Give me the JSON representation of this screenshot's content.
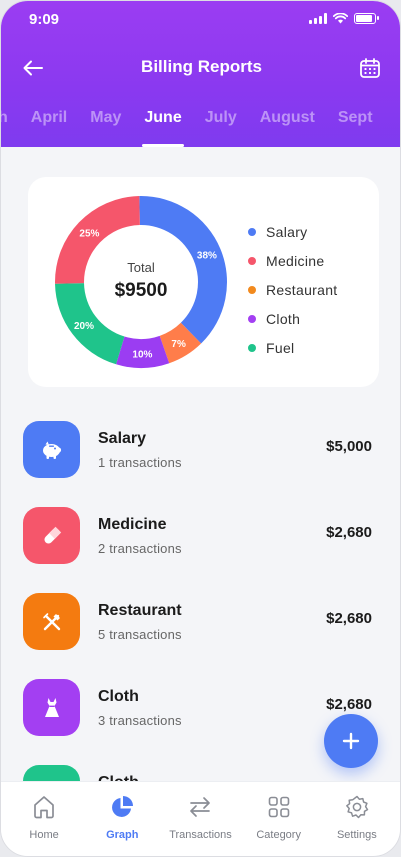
{
  "status_bar": {
    "time": "9:09"
  },
  "header": {
    "title": "Billing Reports"
  },
  "months": [
    "arch",
    "April",
    "May",
    "June",
    "July",
    "August",
    "Sept"
  ],
  "active_month": "June",
  "chart_data": {
    "type": "pie",
    "center_label": "Total",
    "center_value": "$9500",
    "slices": [
      {
        "name": "Salary",
        "value": 38,
        "label": "38%",
        "color": "#4e7bf4"
      },
      {
        "name": "Restaurant",
        "value": 7,
        "label": "7%",
        "color": "#ff7d4a"
      },
      {
        "name": "Cloth",
        "value": 10,
        "label": "10%",
        "color": "#9b3df2"
      },
      {
        "name": "Fuel",
        "value": 20,
        "label": "20%",
        "color": "#1fc48b"
      },
      {
        "name": "Medicine",
        "value": 25,
        "label": "25%",
        "color": "#f5566b"
      }
    ],
    "legend": [
      {
        "name": "Salary",
        "color": "#4e7bf4"
      },
      {
        "name": "Medicine",
        "color": "#f5566b"
      },
      {
        "name": "Restaurant",
        "color": "#f28a1e"
      },
      {
        "name": "Cloth",
        "color": "#a33ff2"
      },
      {
        "name": "Fuel",
        "color": "#1fc48b"
      }
    ]
  },
  "transactions": [
    {
      "name": "Salary",
      "sub": "1 transactions",
      "amount": "$5,000",
      "color": "#4e7bf4",
      "icon": "piggy-bank-icon"
    },
    {
      "name": "Medicine",
      "sub": "2 transactions",
      "amount": "$2,680",
      "color": "#f5566b",
      "icon": "pill-icon"
    },
    {
      "name": "Restaurant",
      "sub": "5 transactions",
      "amount": "$2,680",
      "color": "#f47b10",
      "icon": "cutlery-icon"
    },
    {
      "name": "Cloth",
      "sub": "3 transactions",
      "amount": "$2,680",
      "color": "#a33ff2",
      "icon": "dress-icon"
    },
    {
      "name": "Cloth",
      "sub": "",
      "amount": "",
      "color": "#1fc48b",
      "icon": "category-icon"
    }
  ],
  "nav": [
    {
      "label": "Home",
      "icon": "home-icon"
    },
    {
      "label": "Graph",
      "icon": "pie-chart-icon",
      "active": true
    },
    {
      "label": "Transactions",
      "icon": "transfer-icon"
    },
    {
      "label": "Category",
      "icon": "grid-icon"
    },
    {
      "label": "Settings",
      "icon": "gear-icon"
    }
  ]
}
